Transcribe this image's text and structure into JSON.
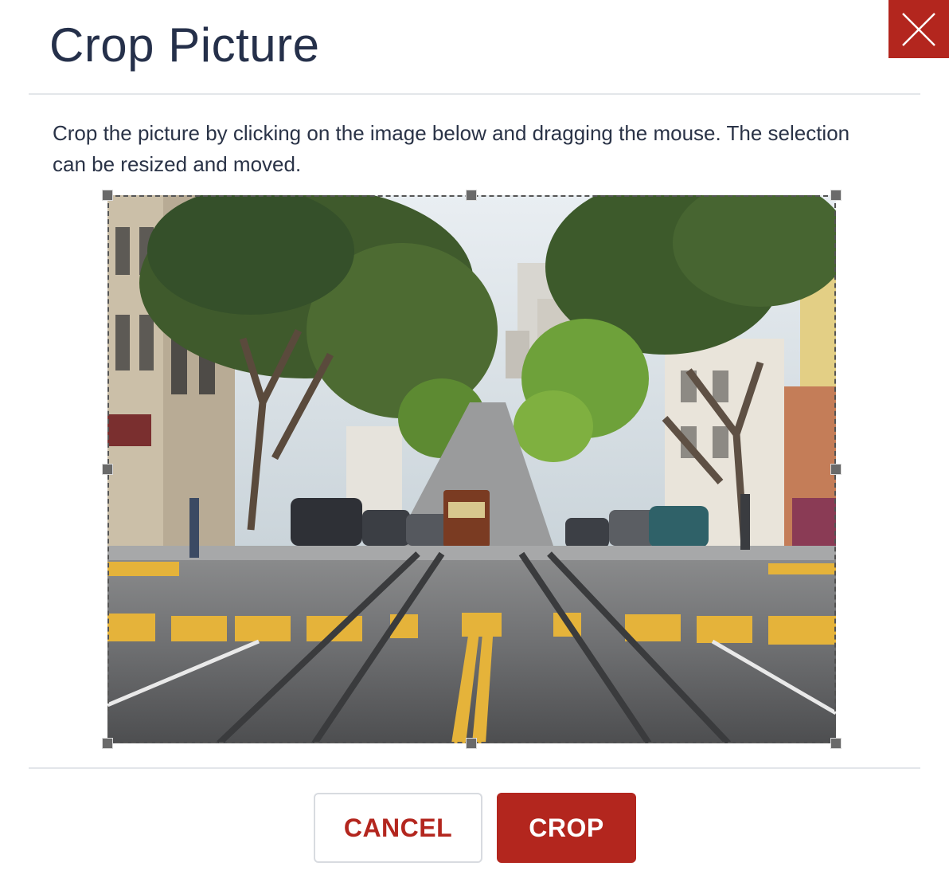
{
  "dialog": {
    "title": "Crop Picture",
    "instructions": "Crop the picture by clicking on the image below and dragging the mouse. The selection can be resized and moved.",
    "close_icon": "close-icon"
  },
  "image": {
    "subject": "street-photo"
  },
  "buttons": {
    "cancel_label": "CANCEL",
    "crop_label": "CROP"
  },
  "colors": {
    "accent": "#b3261e",
    "title": "#25304a",
    "text": "#2a3347",
    "divider": "#e3e6ea"
  }
}
